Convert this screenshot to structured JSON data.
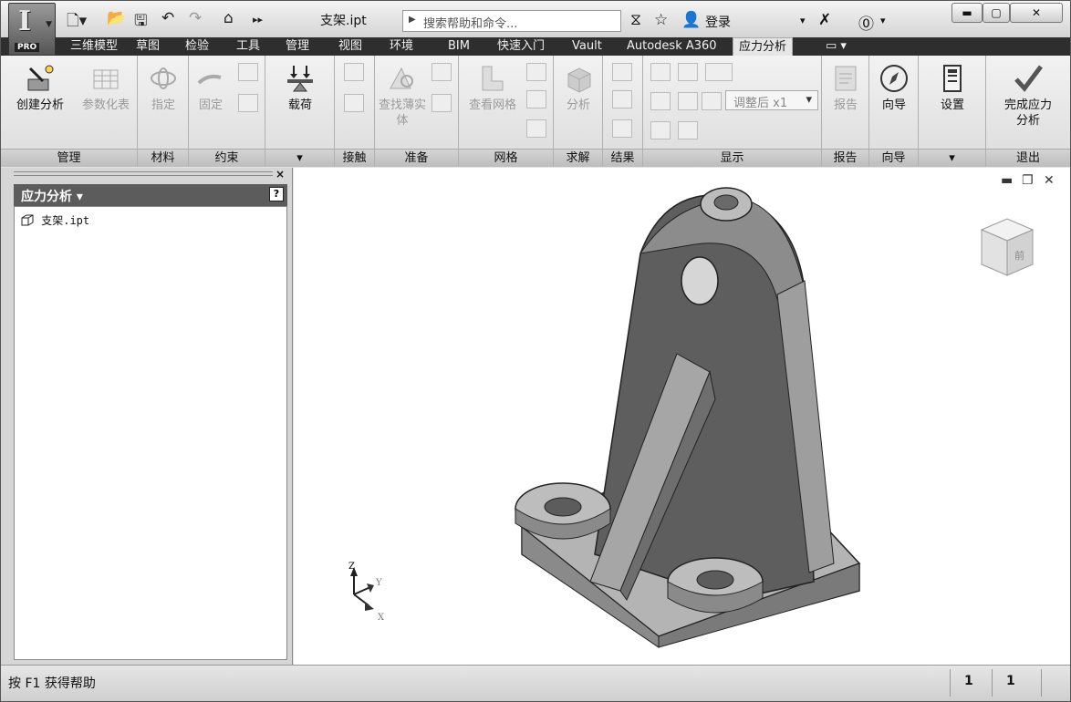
{
  "title_bar": {
    "doc_title": "支架.ipt",
    "search_placeholder": "搜索帮助和命令...",
    "login_label": "登录",
    "pro_badge": "PRO"
  },
  "tabs": [
    {
      "label": "三维模型"
    },
    {
      "label": "草图"
    },
    {
      "label": "检验"
    },
    {
      "label": "工具"
    },
    {
      "label": "管理"
    },
    {
      "label": "视图"
    },
    {
      "label": "环境"
    },
    {
      "label": "BIM"
    },
    {
      "label": "快速入门"
    },
    {
      "label": "Vault"
    },
    {
      "label": "Autodesk A360"
    },
    {
      "label": "应力分析",
      "active": true
    }
  ],
  "ribbon": {
    "panels": {
      "manage": "管理",
      "material": "材料",
      "constraint": "约束",
      "load": "▾",
      "contact": "接触",
      "prepare": "准备",
      "mesh": "网格",
      "solve": "求解",
      "result": "结果",
      "display": "显示",
      "report": "报告",
      "guide": "向导",
      "settings": "▾",
      "exit": "退出"
    },
    "buttons": {
      "create_analysis": "创建分析",
      "param_table": "参数化表",
      "assign": "指定",
      "fixed": "固定",
      "loads": "载荷",
      "find_thin_bodies": "查找薄实体",
      "view_mesh": "查看网格",
      "analyze": "分析",
      "adjust_select": "调整后 x1",
      "report": "报告",
      "guide": "向导",
      "settings": "设置",
      "finish": "完成应力分析"
    }
  },
  "browser": {
    "header": "应力分析 ▾",
    "items": [
      {
        "label": "支架.ipt"
      }
    ]
  },
  "axis_labels": {
    "z": "Z",
    "y": "Y",
    "x": "X"
  },
  "viewcube_label": "前",
  "status": {
    "help_text": "按 F1 获得帮助",
    "count1": "1",
    "count2": "1"
  },
  "colors": {
    "tab_strip": "#2e2e2e",
    "model_face_dark": "#5e5e5e",
    "model_face_light": "#a8a8a8"
  },
  "icons": [
    "search-icon",
    "star-icon",
    "user-icon",
    "help-icon",
    "home-icon",
    "undo-icon",
    "redo-icon",
    "save-icon",
    "open-icon",
    "new-icon",
    "check-icon",
    "compass-icon",
    "viewcube-icon"
  ]
}
